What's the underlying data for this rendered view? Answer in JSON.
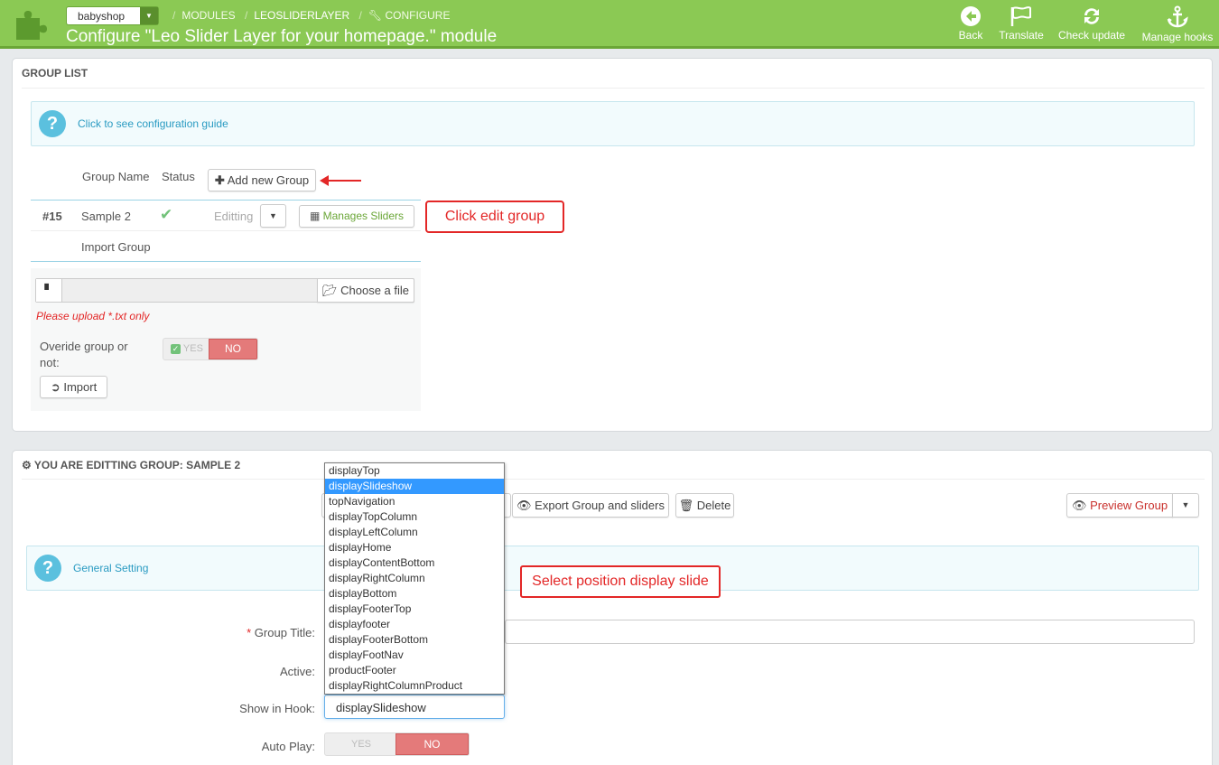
{
  "header": {
    "shop_selector": "babyshop",
    "breadcrumb": [
      "MODULES",
      "LEOSLIDERLAYER",
      "CONFIGURE"
    ],
    "title": "Configure \"Leo Slider Layer for your homepage.\" module",
    "toolbar": [
      {
        "label": "Back",
        "icon": "arrow-left-circle-icon"
      },
      {
        "label": "Translate",
        "icon": "flag-icon"
      },
      {
        "label": "Check update",
        "icon": "refresh-icon"
      },
      {
        "label": "Manage hooks",
        "icon": "anchor-icon"
      }
    ]
  },
  "group_list": {
    "title": "GROUP LIST",
    "guide_link": "Click to see configuration guide",
    "columns": {
      "name": "Group Name",
      "status": "Status"
    },
    "add_button": "Add new Group",
    "row": {
      "id": "#15",
      "name": "Sample 2",
      "status_icon": "check-icon",
      "action": "Editting",
      "manage": "Manages Sliders"
    },
    "import_label": "Import Group",
    "choose_file": "Choose a file",
    "upload_hint": "Please upload *.txt only",
    "override_label": "Overide group or not:",
    "yes": "YES",
    "no": "NO",
    "import_button": "Import"
  },
  "annotations": {
    "edit_group": "Click edit group",
    "select_position": "Select position display slide"
  },
  "editing": {
    "title": "YOU ARE EDITTING GROUP: SAMPLE 2",
    "export_button": "Export Group and sliders",
    "delete_button": "Delete",
    "preview_button": "Preview Group",
    "general_setting": "General Setting",
    "group_title_label": "Group Title:",
    "active_label": "Active:",
    "show_in_hook_label": "Show in Hook:",
    "show_in_hook_value": "displaySlideshow",
    "auto_play_label": "Auto Play:",
    "auto_play_yes": "YES",
    "auto_play_no": "NO",
    "hook_options": [
      "displayTop",
      "displaySlideshow",
      "topNavigation",
      "displayTopColumn",
      "displayLeftColumn",
      "displayHome",
      "displayContentBottom",
      "displayRightColumn",
      "displayBottom",
      "displayFooterTop",
      "displayfooter",
      "displayFooterBottom",
      "displayFootNav",
      "productFooter",
      "displayRightColumnProduct"
    ],
    "hook_selected": "displaySlideshow"
  },
  "colors": {
    "header_green": "#8bc954",
    "no_red": "#e47a7a",
    "link_blue": "#2a9bc2",
    "annotation_red": "#e32727"
  }
}
